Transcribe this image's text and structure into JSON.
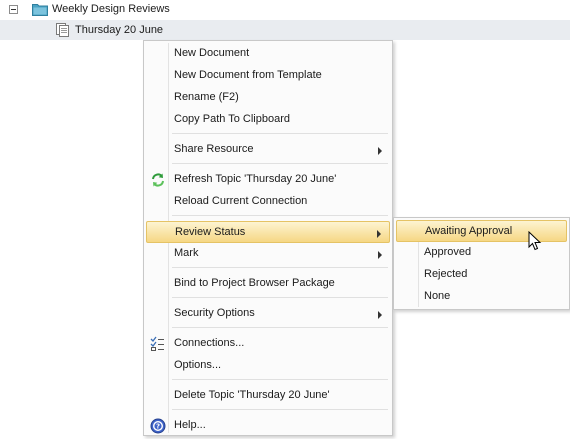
{
  "tree": {
    "root_label": "Weekly Design Reviews",
    "child_label": "Thursday 20 June"
  },
  "menu": {
    "new_document": "New Document",
    "new_document_template": "New Document from Template",
    "rename": "Rename (F2)",
    "copy_path": "Copy Path To Clipboard",
    "share_resource": "Share Resource",
    "refresh_topic": "Refresh Topic 'Thursday 20 June'",
    "reload_connection": "Reload Current Connection",
    "review_status": "Review Status",
    "mark": "Mark",
    "bind_package": "Bind to Project Browser Package",
    "security_options": "Security Options",
    "connections": "Connections...",
    "options": "Options...",
    "delete_topic": "Delete Topic 'Thursday 20 June'",
    "help": "Help..."
  },
  "review_submenu": {
    "awaiting_approval": "Awaiting Approval",
    "approved": "Approved",
    "rejected": "Rejected",
    "none": "None"
  },
  "colors": {
    "highlight_top": "#fdf4d2",
    "highlight_bottom": "#f6d784",
    "selected_row": "#e9ecf0",
    "folder": "#3a8fb0"
  },
  "icons": [
    "collapse-icon",
    "folder-icon",
    "document-topic-icon",
    "refresh-icon",
    "checklist-icon",
    "help-icon",
    "mouse-pointer-icon"
  ]
}
